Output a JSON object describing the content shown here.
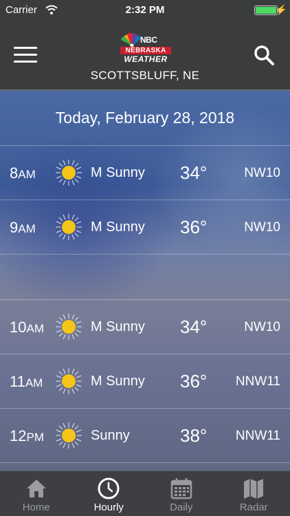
{
  "status_bar": {
    "carrier": "Carrier",
    "time": "2:32 PM",
    "battery_level": 1.0
  },
  "header": {
    "logo_text": {
      "network": "NBC",
      "state": "NEBRASKA",
      "brand": "WEATHER"
    },
    "location": "SCOTTSBLUFF, NE",
    "menu_icon": "hamburger-icon",
    "search_icon": "search-icon"
  },
  "main": {
    "date": "Today, February 28, 2018",
    "hours": [
      {
        "hour": "8",
        "ampm": "AM",
        "icon": "sun-icon",
        "condition": "M Sunny",
        "temp": "34°",
        "wind": "NW10"
      },
      {
        "hour": "9",
        "ampm": "AM",
        "icon": "sun-icon",
        "condition": "M Sunny",
        "temp": "36°",
        "wind": "NW10"
      },
      {
        "hour": "10",
        "ampm": "AM",
        "icon": "sun-icon",
        "condition": "M Sunny",
        "temp": "34°",
        "wind": "NW10"
      },
      {
        "hour": "11",
        "ampm": "AM",
        "icon": "sun-icon",
        "condition": "M Sunny",
        "temp": "36°",
        "wind": "NNW11"
      },
      {
        "hour": "12",
        "ampm": "PM",
        "icon": "sun-icon",
        "condition": "Sunny",
        "temp": "38°",
        "wind": "NNW11"
      }
    ]
  },
  "tabbar": {
    "tabs": [
      {
        "label": "Home",
        "icon": "home-icon",
        "active": false
      },
      {
        "label": "Hourly",
        "icon": "clock-icon",
        "active": true
      },
      {
        "label": "Daily",
        "icon": "calendar-icon",
        "active": false
      },
      {
        "label": "Radar",
        "icon": "map-icon",
        "active": false
      }
    ]
  },
  "colors": {
    "bar_background": "#3b3c3e",
    "battery": "#4cd964",
    "sun": "#f5c518",
    "logo_red": "#cc1f2d"
  }
}
